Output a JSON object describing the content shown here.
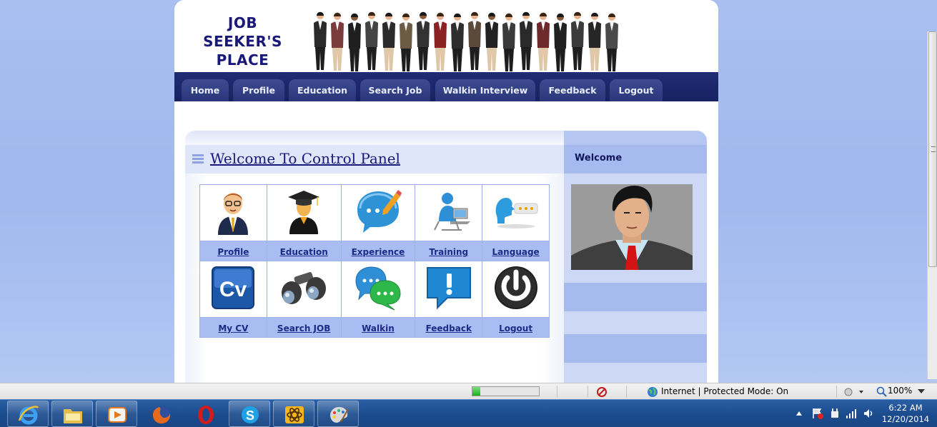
{
  "site": {
    "logo_lines": [
      "JOB",
      "SEEKER'S",
      "PLACE"
    ]
  },
  "nav": {
    "tabs": [
      {
        "label": "Home"
      },
      {
        "label": "Profile"
      },
      {
        "label": "Education"
      },
      {
        "label": "Search Job"
      },
      {
        "label": "Walkin Interview"
      },
      {
        "label": "Feedback"
      },
      {
        "label": "Logout"
      }
    ]
  },
  "panel": {
    "title": "Welcome To Control Panel",
    "row1": [
      {
        "label": "Profile",
        "icon": "businessman-icon"
      },
      {
        "label": "Education",
        "icon": "graduate-icon"
      },
      {
        "label": "Experience",
        "icon": "speech-bubble-pencil-icon"
      },
      {
        "label": "Training",
        "icon": "person-at-laptop-icon"
      },
      {
        "label": "Language",
        "icon": "speaking-head-icon"
      }
    ],
    "row2": [
      {
        "label": "My CV",
        "icon": "cv-icon"
      },
      {
        "label": "Search JOB",
        "icon": "binoculars-icon"
      },
      {
        "label": "Walkin",
        "icon": "chat-bubbles-icon"
      },
      {
        "label": "Feedback",
        "icon": "exclamation-bubble-icon"
      },
      {
        "label": "Logout",
        "icon": "power-icon"
      }
    ]
  },
  "sidebar": {
    "heading": "Welcome"
  },
  "statusbar": {
    "zone": "Internet | Protected Mode: On",
    "zoom": "100%",
    "progress": 0.12
  },
  "taskbar": {
    "time": "6:22 AM",
    "date": "12/20/2014"
  },
  "colors": {
    "nav_bg": "#1c2768",
    "link": "#1e2a86",
    "label_bg": "#a9bdf2",
    "title": "#17187a"
  }
}
